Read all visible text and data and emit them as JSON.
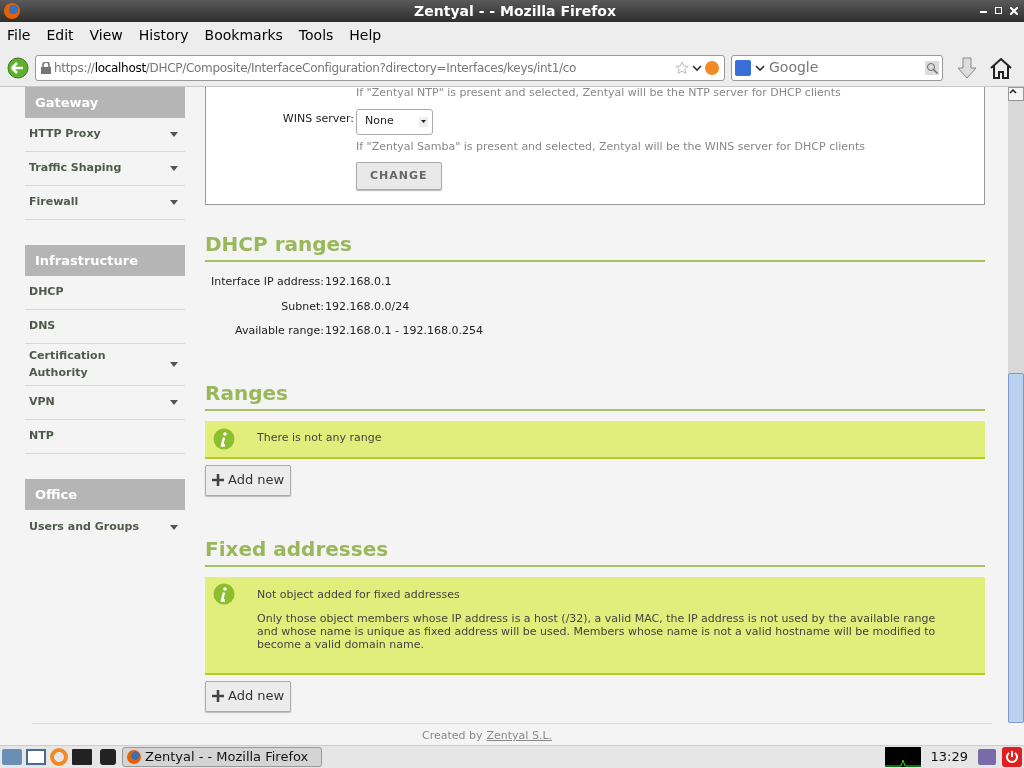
{
  "window": {
    "title": "Zentyal - - Mozilla Firefox"
  },
  "menu": [
    "File",
    "Edit",
    "View",
    "History",
    "Bookmarks",
    "Tools",
    "Help"
  ],
  "navbar": {
    "url_host": "https://localhost",
    "url_path": "/DHCP/Composite/InterfaceConfiguration?directory=Interfaces/keys/int1/co",
    "search_placeholder": "Google"
  },
  "sidebar": [
    {
      "kind": "header",
      "label": "Gateway"
    },
    {
      "kind": "item",
      "label": "HTTP Proxy",
      "has_submenu": true
    },
    {
      "kind": "item",
      "label": "Traffic Shaping",
      "has_submenu": true
    },
    {
      "kind": "item",
      "label": "Firewall",
      "has_submenu": true
    },
    {
      "kind": "header",
      "label": "Infrastructure"
    },
    {
      "kind": "item",
      "label": "DHCP",
      "has_submenu": false
    },
    {
      "kind": "item",
      "label": "DNS",
      "has_submenu": false
    },
    {
      "kind": "item",
      "label": "Certification Authority",
      "has_submenu": true
    },
    {
      "kind": "item",
      "label": "VPN",
      "has_submenu": true
    },
    {
      "kind": "item",
      "label": "NTP",
      "has_submenu": false
    },
    {
      "kind": "header",
      "label": "Office"
    },
    {
      "kind": "item",
      "label": "Users and Groups",
      "has_submenu": true
    }
  ],
  "form": {
    "ntp_hint": "If \"Zentyal NTP\" is present and selected, Zentyal will be the NTP server for DHCP clients",
    "wins_label": "WINS server:",
    "wins_value": "None",
    "wins_hint": "If \"Zentyal Samba\" is present and selected, Zentyal will be the WINS server for DHCP clients",
    "button": "CHANGE"
  },
  "dhcp_ranges": {
    "title": "DHCP ranges",
    "rows": [
      {
        "label": "Interface IP address:",
        "value": "192.168.0.1"
      },
      {
        "label": "Subnet:",
        "value": "192.168.0.0/24"
      },
      {
        "label": "Available range:",
        "value": "192.168.0.1 - 192.168.0.254"
      }
    ]
  },
  "ranges": {
    "title": "Ranges",
    "message": "There is not any range",
    "button": "Add new"
  },
  "fixed_addresses": {
    "title": "Fixed addresses",
    "message": "Not object added for fixed addresses",
    "detail": "Only those object members whose IP address is a host (/32), a valid MAC, the IP address is not used by the available range and whose name is unique as fixed address will be used. Members whose name is not a valid hostname will be modified to become a valid domain name.",
    "button": "Add new"
  },
  "footer": {
    "text": "Created by",
    "link": "Zentyal S.L."
  },
  "taskbar": {
    "window": "Zentyal - - Mozilla Firefox",
    "clock": "13:29"
  }
}
